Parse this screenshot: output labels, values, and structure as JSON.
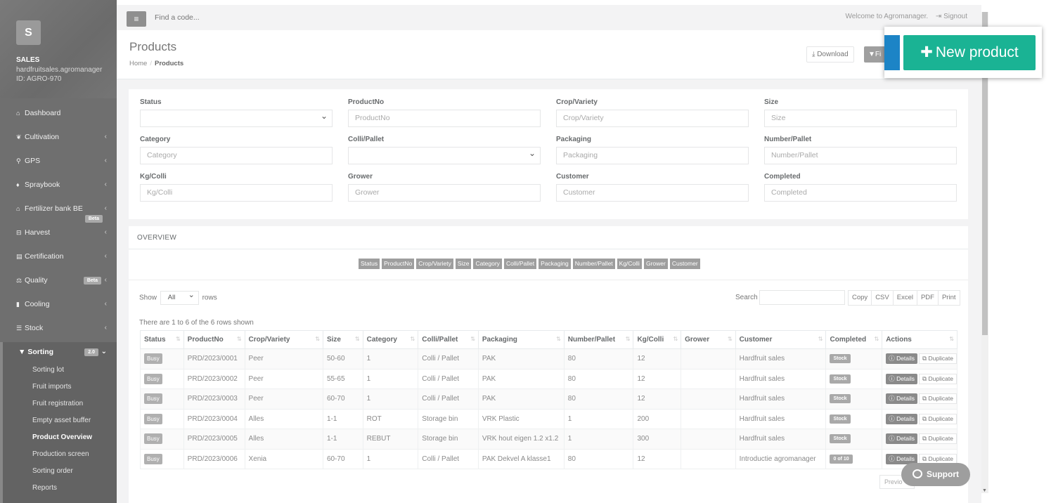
{
  "sidebar": {
    "logo_letter": "S",
    "account_name": "SALES",
    "account_domain": "hardfruitsales.agromanager",
    "account_id": "ID: AGRO-970",
    "items": [
      {
        "label": "Dashboard",
        "icon": "home-icon",
        "glyph": "⌂"
      },
      {
        "label": "Cultivation",
        "icon": "leaf-icon",
        "glyph": "❦"
      },
      {
        "label": "GPS",
        "icon": "map-marker-icon",
        "glyph": "⚲"
      },
      {
        "label": "Spraybook",
        "icon": "drop-icon",
        "glyph": "♦"
      },
      {
        "label": "Fertilizer bank BE",
        "icon": "bank-icon",
        "glyph": "⌂",
        "badge": "Beta"
      },
      {
        "label": "Harvest",
        "icon": "basket-icon",
        "glyph": "⊟"
      },
      {
        "label": "Certification",
        "icon": "book-icon",
        "glyph": "▤"
      },
      {
        "label": "Quality",
        "icon": "balance-icon",
        "glyph": "⚖",
        "badge": "Beta"
      },
      {
        "label": "Cooling",
        "icon": "thermometer-icon",
        "glyph": "▮"
      },
      {
        "label": "Stock",
        "icon": "list-icon",
        "glyph": "☰"
      }
    ],
    "sorting": {
      "label": "Sorting",
      "badge": "2.0",
      "items": [
        "Sorting lot",
        "Fruit imports",
        "Fruit registration",
        "Empty asset buffer",
        "Product Overview",
        "Production screen",
        "Sorting order",
        "Reports"
      ],
      "active": "Product Overview"
    }
  },
  "topbar": {
    "search_placeholder": "Find a code...",
    "welcome": "Welcome to Agromanager.",
    "signout": "Signout"
  },
  "heading": {
    "title": "Products",
    "breadcrumb_home": "Home",
    "breadcrumb_current": "Products",
    "download_label": "Download",
    "filter_label": "Fi",
    "new_product_label": "New product"
  },
  "filters": {
    "status_label": "Status",
    "productno_label": "ProductNo",
    "productno_ph": "ProductNo",
    "crop_label": "Crop/Variety",
    "crop_ph": "Crop/Variety",
    "size_label": "Size",
    "size_ph": "Size",
    "category_label": "Category",
    "category_ph": "Category",
    "colli_label": "Colli/Pallet",
    "packaging_label": "Packaging",
    "packaging_ph": "Packaging",
    "numpallet_label": "Number/Pallet",
    "numpallet_ph": "Number/Pallet",
    "kgcolli_label": "Kg/Colli",
    "kgcolli_ph": "Kg/Colli",
    "grower_label": "Grower",
    "grower_ph": "Grower",
    "customer_label": "Customer",
    "customer_ph": "Customer",
    "completed_label": "Completed",
    "completed_ph": "Completed"
  },
  "overview": {
    "title": "OVERVIEW",
    "column_toggles": [
      "Status",
      "ProductNo",
      "Crop/Variety",
      "Size",
      "Category",
      "Colli/Pallet",
      "Packaging",
      "Number/Pallet",
      "Kg/Colli",
      "Grower",
      "Customer"
    ],
    "show_label": "Show",
    "show_value": "All",
    "rows_label": "rows",
    "search_label": "Search",
    "export_buttons": [
      "Copy",
      "CSV",
      "Excel",
      "PDF",
      "Print"
    ],
    "info": "There are 1 to 6 of the 6 rows shown",
    "columns": [
      "Status",
      "ProductNo",
      "Crop/Variety",
      "Size",
      "Category",
      "Colli/Pallet",
      "Packaging",
      "Number/Pallet",
      "Kg/Colli",
      "Grower",
      "Customer",
      "Completed",
      "Actions"
    ],
    "rows": [
      [
        "Busy",
        "PRD/2023/0001",
        "Peer",
        "50-60",
        "1",
        "Colli / Pallet",
        "PAK",
        "80",
        "12",
        "",
        "Hardfruit sales",
        "Stock"
      ],
      [
        "Busy",
        "PRD/2023/0002",
        "Peer",
        "55-65",
        "1",
        "Colli / Pallet",
        "PAK",
        "80",
        "12",
        "",
        "Hardfruit sales",
        "Stock"
      ],
      [
        "Busy",
        "PRD/2023/0003",
        "Peer",
        "60-70",
        "1",
        "Colli / Pallet",
        "PAK",
        "80",
        "12",
        "",
        "Hardfruit sales",
        "Stock"
      ],
      [
        "Busy",
        "PRD/2023/0004",
        "Alles",
        "1-1",
        "ROT",
        "Storage bin",
        "VRK Plastic",
        "1",
        "200",
        "",
        "Hardfruit sales",
        "Stock"
      ],
      [
        "Busy",
        "PRD/2023/0005",
        "Alles",
        "1-1",
        "REBUT",
        "Storage bin",
        "VRK hout eigen 1.2 x1.2",
        "1",
        "300",
        "",
        "Hardfruit sales",
        "Stock"
      ],
      [
        "Busy",
        "PRD/2023/0006",
        "Xenia",
        "60-70",
        "1",
        "Colli / Pallet",
        "PAK Dekvel A klasse1",
        "80",
        "12",
        "",
        "Introductie agromanager",
        "0 of 10"
      ]
    ],
    "details_label": "Details",
    "duplicate_label": "Duplicate",
    "prev_label": "Previo"
  },
  "support_label": "Support",
  "colors": {
    "sidebar": "#6f6f6f",
    "accent_green": "#1ab394",
    "accent_blue": "#1c84c6"
  }
}
